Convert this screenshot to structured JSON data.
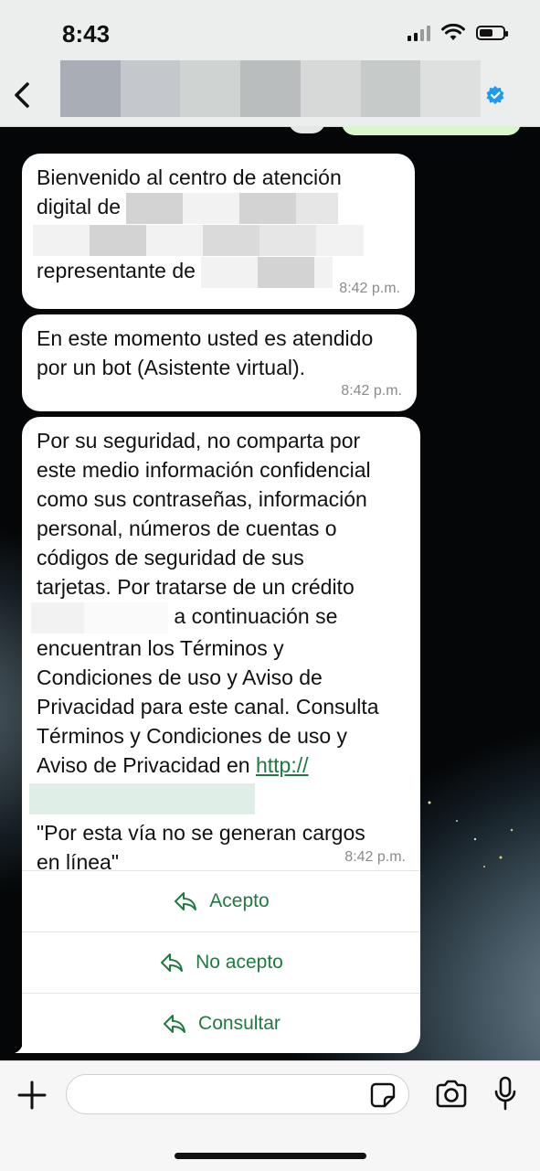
{
  "status_bar": {
    "time": "8:43"
  },
  "header": {
    "back_label": "back",
    "contact_name": ""
  },
  "messages": [
    {
      "line1": "Bienvenido al centro de atención",
      "line2_prefix": "digital de",
      "line4_prefix": "representante de",
      "time": "8:42 p.m."
    },
    {
      "text": "En este momento usted es atendido por un bot (Asistente virtual).",
      "time": "8:42 p.m."
    },
    {
      "line1": "Por su seguridad, no comparta por",
      "line2": "este medio información confidencial",
      "line3": "como sus contraseñas, información",
      "line4": "personal, números de cuentas o",
      "line5": "códigos de seguridad de sus",
      "line6": "tarjetas. Por tratarse de un crédito",
      "line7_suffix": "a continuación se",
      "line8": "encuentran los Términos y",
      "line9": "Condiciones de uso y Aviso de",
      "line10": "Privacidad para este canal. Consulta",
      "line11": "Términos y Condiciones de uso y",
      "line12_prefix": "Aviso de Privacidad en",
      "link_text": "http://",
      "line13": " \"Por esta vía no se generan cargos",
      "line14": "en línea\"",
      "time": "8:42 p.m.",
      "buttons": [
        "Acepto",
        "No acepto",
        "Consultar"
      ]
    }
  ],
  "composer": {
    "placeholder": ""
  },
  "colors": {
    "accent": "#1f7a42",
    "verified": "#1d9bf0",
    "bubble": "#ffffff",
    "outgoing": "#d9f7cd"
  }
}
